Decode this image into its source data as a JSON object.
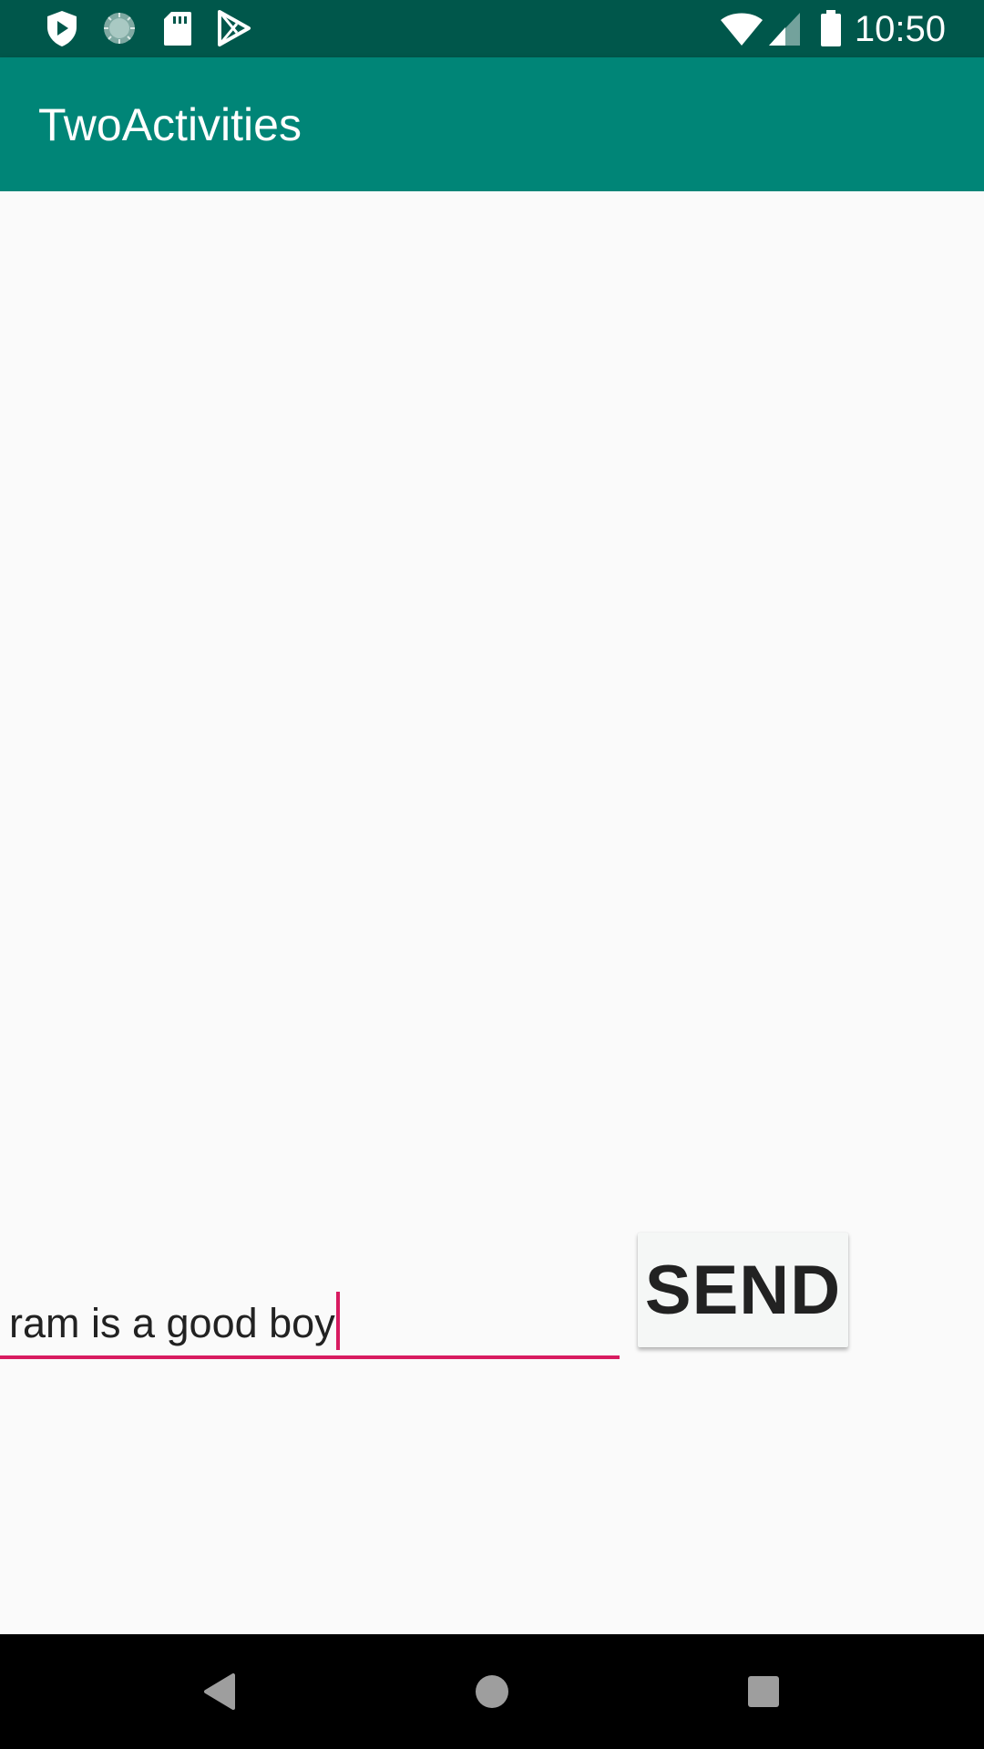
{
  "status_bar": {
    "time": "10:50",
    "left_icons": [
      "shield-play-icon",
      "loading-circle-icon",
      "sd-card-icon",
      "play-store-icon"
    ],
    "right_icons": [
      "wifi-icon",
      "signal-icon",
      "battery-icon"
    ],
    "background_color": "#00574b"
  },
  "app_bar": {
    "title": "TwoActivities",
    "background_color": "#008577"
  },
  "main": {
    "message_input": {
      "value": "ram is a good boy",
      "accent_color": "#d81b60"
    },
    "send_button": {
      "label": "SEND"
    }
  },
  "nav_bar": {
    "buttons": [
      "back-icon",
      "home-icon",
      "recents-icon"
    ]
  }
}
